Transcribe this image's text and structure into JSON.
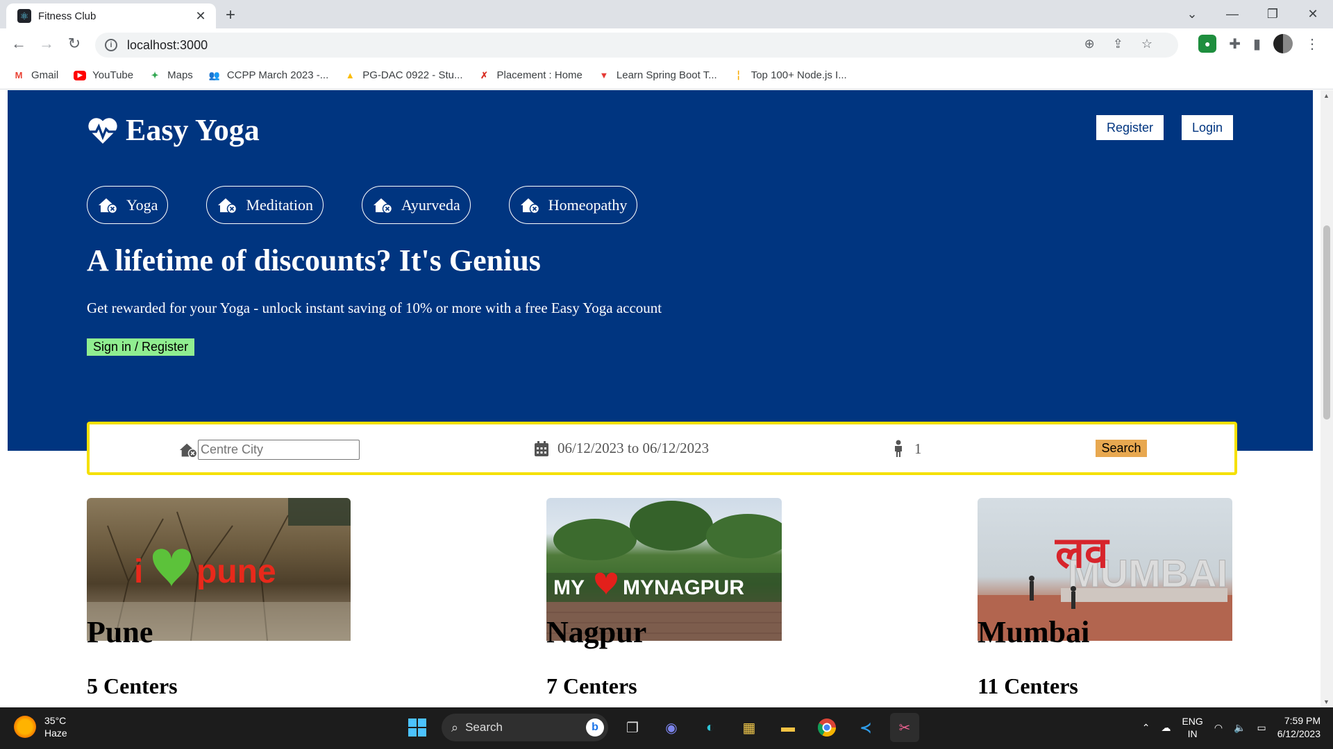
{
  "browser": {
    "tab_title": "Fitness Club",
    "url": "localhost:3000",
    "bookmarks": [
      {
        "label": "Gmail",
        "icon": "gmail-icon",
        "color": "#ea4335"
      },
      {
        "label": "YouTube",
        "icon": "youtube-icon",
        "color": "#ff0000"
      },
      {
        "label": "Maps",
        "icon": "maps-icon",
        "color": "#34a853"
      },
      {
        "label": "CCPP March 2023 -...",
        "icon": "people-icon",
        "color": "#4285f4"
      },
      {
        "label": "PG-DAC 0922 - Stu...",
        "icon": "drive-icon",
        "color": "#fbbc04"
      },
      {
        "label": "Placement : Home",
        "icon": "runner-icon",
        "color": "#d93025"
      },
      {
        "label": "Learn Spring Boot T...",
        "icon": "triangle-icon",
        "color": "#e53935"
      },
      {
        "label": "Top 100+ Node.js I...",
        "icon": "bars-icon",
        "color": "#f9ab00"
      }
    ]
  },
  "page": {
    "brand": "Easy Yoga",
    "register_label": "Register",
    "login_label": "Login",
    "categories": [
      "Yoga",
      "Meditation",
      "Ayurveda",
      "Homeopathy"
    ],
    "headline": "A lifetime of discounts? It's Genius",
    "subline": "Get rewarded for your Yoga - unlock instant saving of 10% or more with a free Easy Yoga account",
    "signin_label": "Sign in / Register",
    "search": {
      "city_placeholder": "Centre City",
      "date_range": "06/12/2023 to 06/12/2023",
      "people": "1",
      "button": "Search"
    },
    "cities": [
      {
        "name": "Pune",
        "centers": "5 Centers",
        "image_text": "pune",
        "image_prefix": "i"
      },
      {
        "name": "Nagpur",
        "centers": "7 Centers",
        "image_text": "MY",
        "image_text2": "MYNAGPUR"
      },
      {
        "name": "Mumbai",
        "centers": "11 Centers",
        "image_text": "लव",
        "image_text2": "MUMBAI"
      }
    ],
    "colors": {
      "hero": "#003580",
      "search_border": "#f5e000",
      "signin_bg": "#90ee90",
      "search_btn": "#e8a850"
    }
  },
  "taskbar": {
    "temperature": "35°C",
    "condition": "Haze",
    "search_label": "Search",
    "lang_top": "ENG",
    "lang_bottom": "IN",
    "time": "7:59 PM",
    "date": "6/12/2023"
  }
}
